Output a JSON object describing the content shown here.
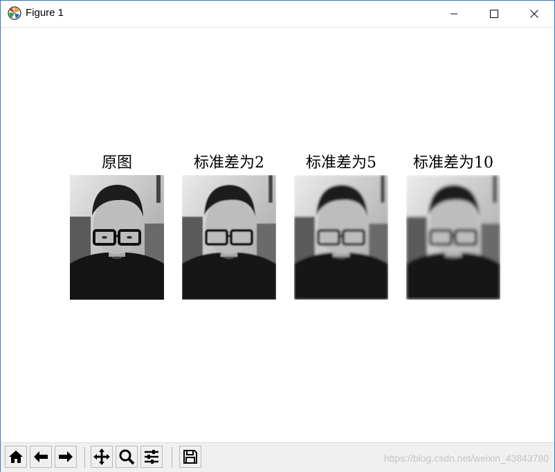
{
  "window": {
    "title": "Figure 1"
  },
  "figure": {
    "panels": [
      {
        "title": "原图"
      },
      {
        "title": "标准差为2"
      },
      {
        "title": "标准差为5"
      },
      {
        "title": "标准差为10"
      }
    ]
  },
  "toolbar": {
    "buttons": [
      "home-icon",
      "back-arrow-icon",
      "forward-arrow-icon",
      "pan-icon",
      "zoom-icon",
      "configure-subplots-icon",
      "save-icon"
    ]
  },
  "watermark": "https://blog.csdn.net/weixin_43843780"
}
